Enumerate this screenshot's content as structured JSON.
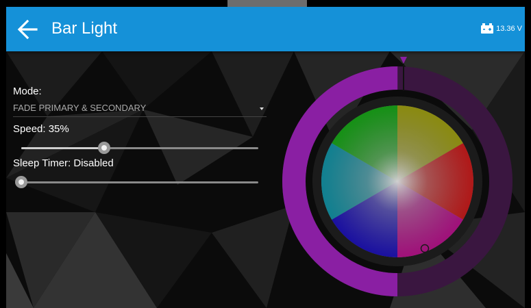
{
  "app_bar": {
    "title": "Bar Light",
    "battery_voltage": "13.36 V",
    "color": "#1591d8"
  },
  "icons": {
    "back": "arrow-left-icon",
    "battery": "battery-icon",
    "dropdown": "dropdown-arrow-icon"
  },
  "mode": {
    "label": "Mode:",
    "value": "FADE PRIMARY & SECONDARY"
  },
  "speed": {
    "label": "Speed: 35%",
    "percent": 35
  },
  "sleep_timer": {
    "label": "Sleep Timer: Disabled",
    "percent": 0
  },
  "color_picker": {
    "ring_color": "#8a1fa3",
    "ring_fill_percent": 50
  }
}
